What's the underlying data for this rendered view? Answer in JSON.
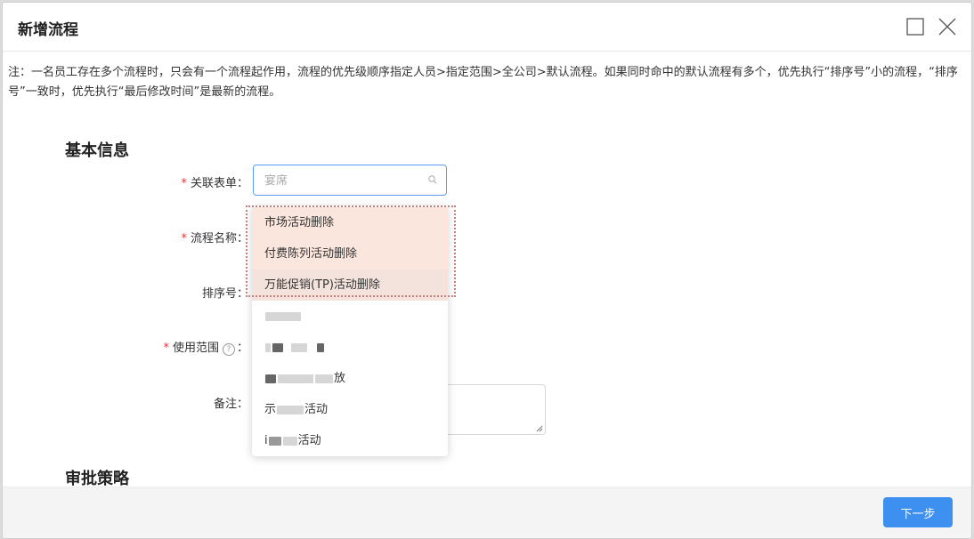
{
  "dialog": {
    "title": "新增流程"
  },
  "note": "注：一名员工存在多个流程时，只会有一个流程起作用，流程的优先级顺序指定人员>指定范围>全公司>默认流程。如果同时命中的默认流程有多个，优先执行“排序号”小的流程，“排序号”一致时，优先执行“最后修改时间”是最新的流程。",
  "sections": {
    "basic": "基本信息",
    "approval": "审批策略"
  },
  "form": {
    "form_label": "关联表单",
    "name_label": "流程名称",
    "order_label": "排序号",
    "scope_label": "使用范围",
    "remark_label": "备注",
    "colon": "：",
    "required_mark": "*",
    "help_mark": "?",
    "search_placeholder": "宴席"
  },
  "dropdown": {
    "items": [
      "市场活动删除",
      "付费陈列活动删除",
      "万能促销(TP)活动删除",
      "万能",
      "",
      "新",
      "",
      ""
    ],
    "item5_suffix": "放",
    "item6_prefix": "示",
    "item6_suffix": "活动",
    "item7_prefix": "i",
    "item7_suffix": "活动"
  },
  "footer": {
    "next_label": "下一步"
  },
  "icons": {
    "maximize": "maximize-icon",
    "close": "close-icon",
    "search": "search-icon",
    "resize": "resize-grip-icon"
  },
  "colors": {
    "primary": "#3d8ff0",
    "required": "#e0363a",
    "highlight": "#fbe6dd",
    "focus_border": "#5b9df0"
  }
}
